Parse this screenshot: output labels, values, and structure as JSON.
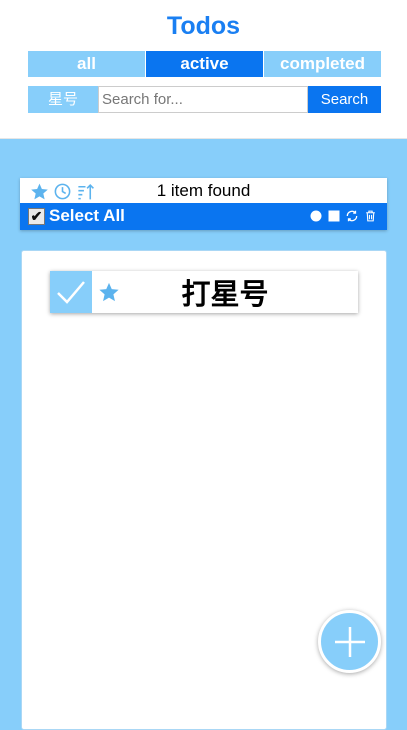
{
  "header": {
    "title": "Todos",
    "filters": [
      "all",
      "active",
      "completed"
    ],
    "active_filter": "active"
  },
  "search": {
    "label": "星号",
    "placeholder": "Search for...",
    "value": "",
    "button_label": "Search"
  },
  "toolbar": {
    "icons": [
      "star-icon",
      "clock-icon",
      "sort-icon"
    ],
    "result_text": "1 item found",
    "select_all_label": "Select All",
    "select_all_checked": true,
    "bulk_icons": [
      "circle-icon",
      "square-icon",
      "refresh-icon",
      "trash-icon"
    ]
  },
  "todos": [
    {
      "text": "打星号",
      "completed": false,
      "starred": true
    }
  ],
  "fab": {
    "icon": "plus-icon"
  },
  "colors": {
    "accent": "#0a75f0",
    "light_blue": "#87cefa",
    "title": "#1a7ff2"
  }
}
